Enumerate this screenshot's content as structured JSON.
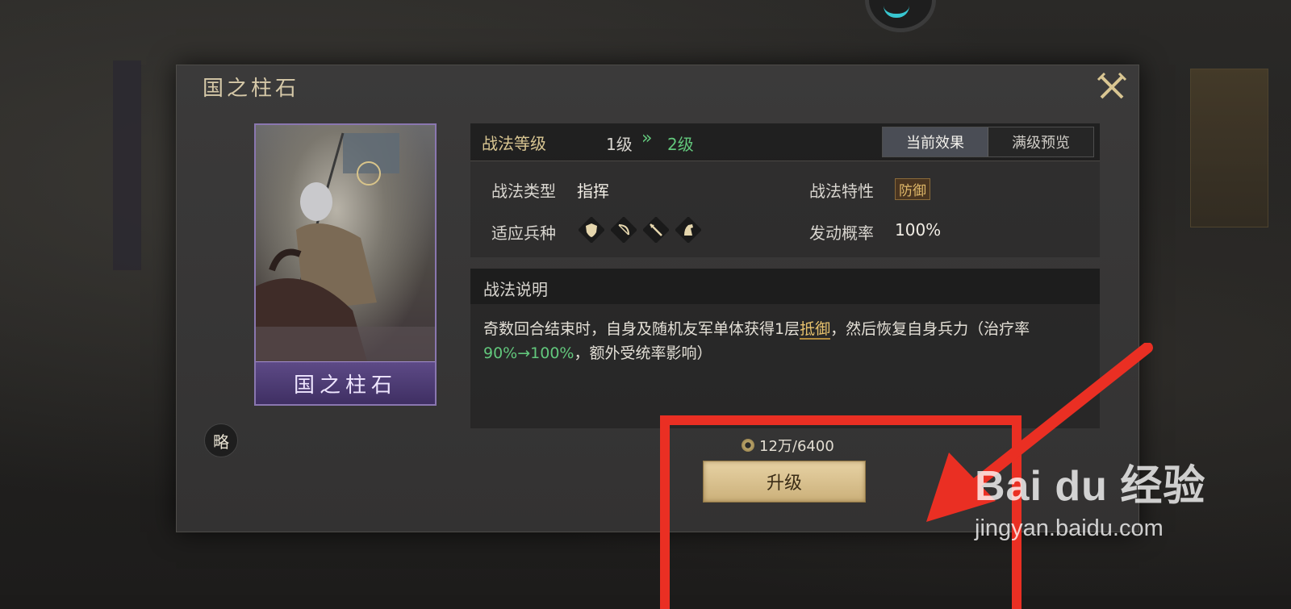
{
  "dialog": {
    "title": "国之柱石",
    "close_icon": "crossed-swords-close-icon"
  },
  "card": {
    "name": "国之柱石",
    "art": "mounted-armored-general-portrait",
    "rarity_color": "#8a77b0"
  },
  "tag": {
    "label": "略"
  },
  "level": {
    "label": "战法等级",
    "current": "1级",
    "arrow": "»",
    "next": "2级",
    "next_color": "#62c77c"
  },
  "tabs": [
    {
      "label": "当前效果",
      "active": true
    },
    {
      "label": "满级预览",
      "active": false
    }
  ],
  "attributes": {
    "type_label": "战法类型",
    "type_value": "指挥",
    "trait_label": "战法特性",
    "trait_value": "防御",
    "troops_label": "适应兵种",
    "troop_icons": [
      "shield-icon",
      "bow-icon",
      "spear-icon",
      "horse-icon"
    ],
    "rate_label": "发动概率",
    "rate_value": "100%"
  },
  "description": {
    "title": "战法说明",
    "part1": "奇数回合结束时，自身及随机友军单体获得1层",
    "keyword": "抵御",
    "part2": "，然后恢复自身兵力（治疗率",
    "heal_rate": "90%→100%",
    "part3": "，额外受统率影响）"
  },
  "upgrade": {
    "cost": "12万/6400",
    "button_label": "升级"
  },
  "watermark": {
    "logo": "Bai du 经验",
    "url": "jingyan.baidu.com"
  },
  "annotation_color": "#ea2f23"
}
